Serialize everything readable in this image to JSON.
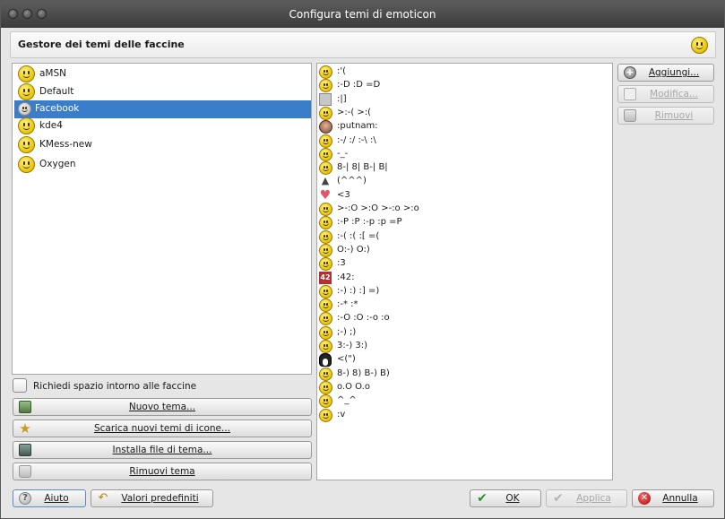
{
  "window": {
    "title": "Configura temi di emoticon"
  },
  "header": {
    "title": "Gestore dei temi delle faccine",
    "icon": "smiley-icon"
  },
  "themes": [
    {
      "label": "aMSN",
      "icon": "amsn-smiley-icon",
      "selected": false
    },
    {
      "label": "Default",
      "icon": "smiley-icon",
      "selected": false
    },
    {
      "label": "Facebook",
      "icon": "facebook-smiley-icon",
      "selected": true
    },
    {
      "label": "kde4",
      "icon": "smiley-icon",
      "selected": false
    },
    {
      "label": "KMess-new",
      "icon": "smiley-icon",
      "selected": false
    },
    {
      "label": "Oxygen",
      "icon": "smiley-icon",
      "selected": false
    }
  ],
  "emoticons": [
    {
      "text": ":'(",
      "icon": "crying-icon"
    },
    {
      "text": ":-D :D =D",
      "icon": "grin-icon"
    },
    {
      "text": ":|]",
      "icon": "robot-icon"
    },
    {
      "text": ">:-( >:(",
      "icon": "angry-icon"
    },
    {
      "text": ":putnam:",
      "icon": "putnam-icon"
    },
    {
      "text": ":-/ :/ :-\\ :\\",
      "icon": "unsure-icon"
    },
    {
      "text": "-_-",
      "icon": "squint-icon"
    },
    {
      "text": "8-| 8| B-| B|",
      "icon": "sunglasses-icon"
    },
    {
      "text": "(^^^)",
      "icon": "shark-icon"
    },
    {
      "text": "<3",
      "icon": "heart-icon"
    },
    {
      "text": ">-:O >:O >-:o >:o",
      "icon": "upset-icon"
    },
    {
      "text": ":-P :P :-p :p =P",
      "icon": "tongue-icon"
    },
    {
      "text": ":-( :( :[ =(",
      "icon": "sad-icon"
    },
    {
      "text": "O:-) O:)",
      "icon": "angel-icon"
    },
    {
      "text": ":3",
      "icon": "curly-lips-icon"
    },
    {
      "text": ":42:",
      "icon": "number-42-icon"
    },
    {
      "text": ":-) :) :] =)",
      "icon": "smile-icon"
    },
    {
      "text": ":-* :*",
      "icon": "kiss-icon"
    },
    {
      "text": ":-O :O :-o :o",
      "icon": "surprised-icon"
    },
    {
      "text": ";-) ;)",
      "icon": "wink-icon"
    },
    {
      "text": "3:-) 3:)",
      "icon": "devil-icon"
    },
    {
      "text": "<(\")",
      "icon": "penguin-icon"
    },
    {
      "text": "8-) 8) B-) B)",
      "icon": "glasses-icon"
    },
    {
      "text": "o.O O.o",
      "icon": "confused-icon"
    },
    {
      "text": "^_^",
      "icon": "happy-icon"
    },
    {
      "text": ":v",
      "icon": "pacman-icon"
    }
  ],
  "side_buttons": {
    "add": "Aggiungi...",
    "edit": "Modifica...",
    "remove": "Rimuovi"
  },
  "checkbox": {
    "label": "Richiedi spazio intorno alle faccine",
    "checked": false
  },
  "theme_buttons": {
    "new": "Nuovo tema...",
    "download": "Scarica nuovi temi di icone...",
    "install": "Installa file di tema...",
    "remove": "Rimuovi tema"
  },
  "footer": {
    "help": "Aiuto",
    "defaults": "Valori predefiniti",
    "ok": "OK",
    "apply": "Applica",
    "cancel": "Annulla"
  },
  "colors": {
    "selection": "#3a7dc9",
    "titlebar": "#4a4a4a"
  }
}
